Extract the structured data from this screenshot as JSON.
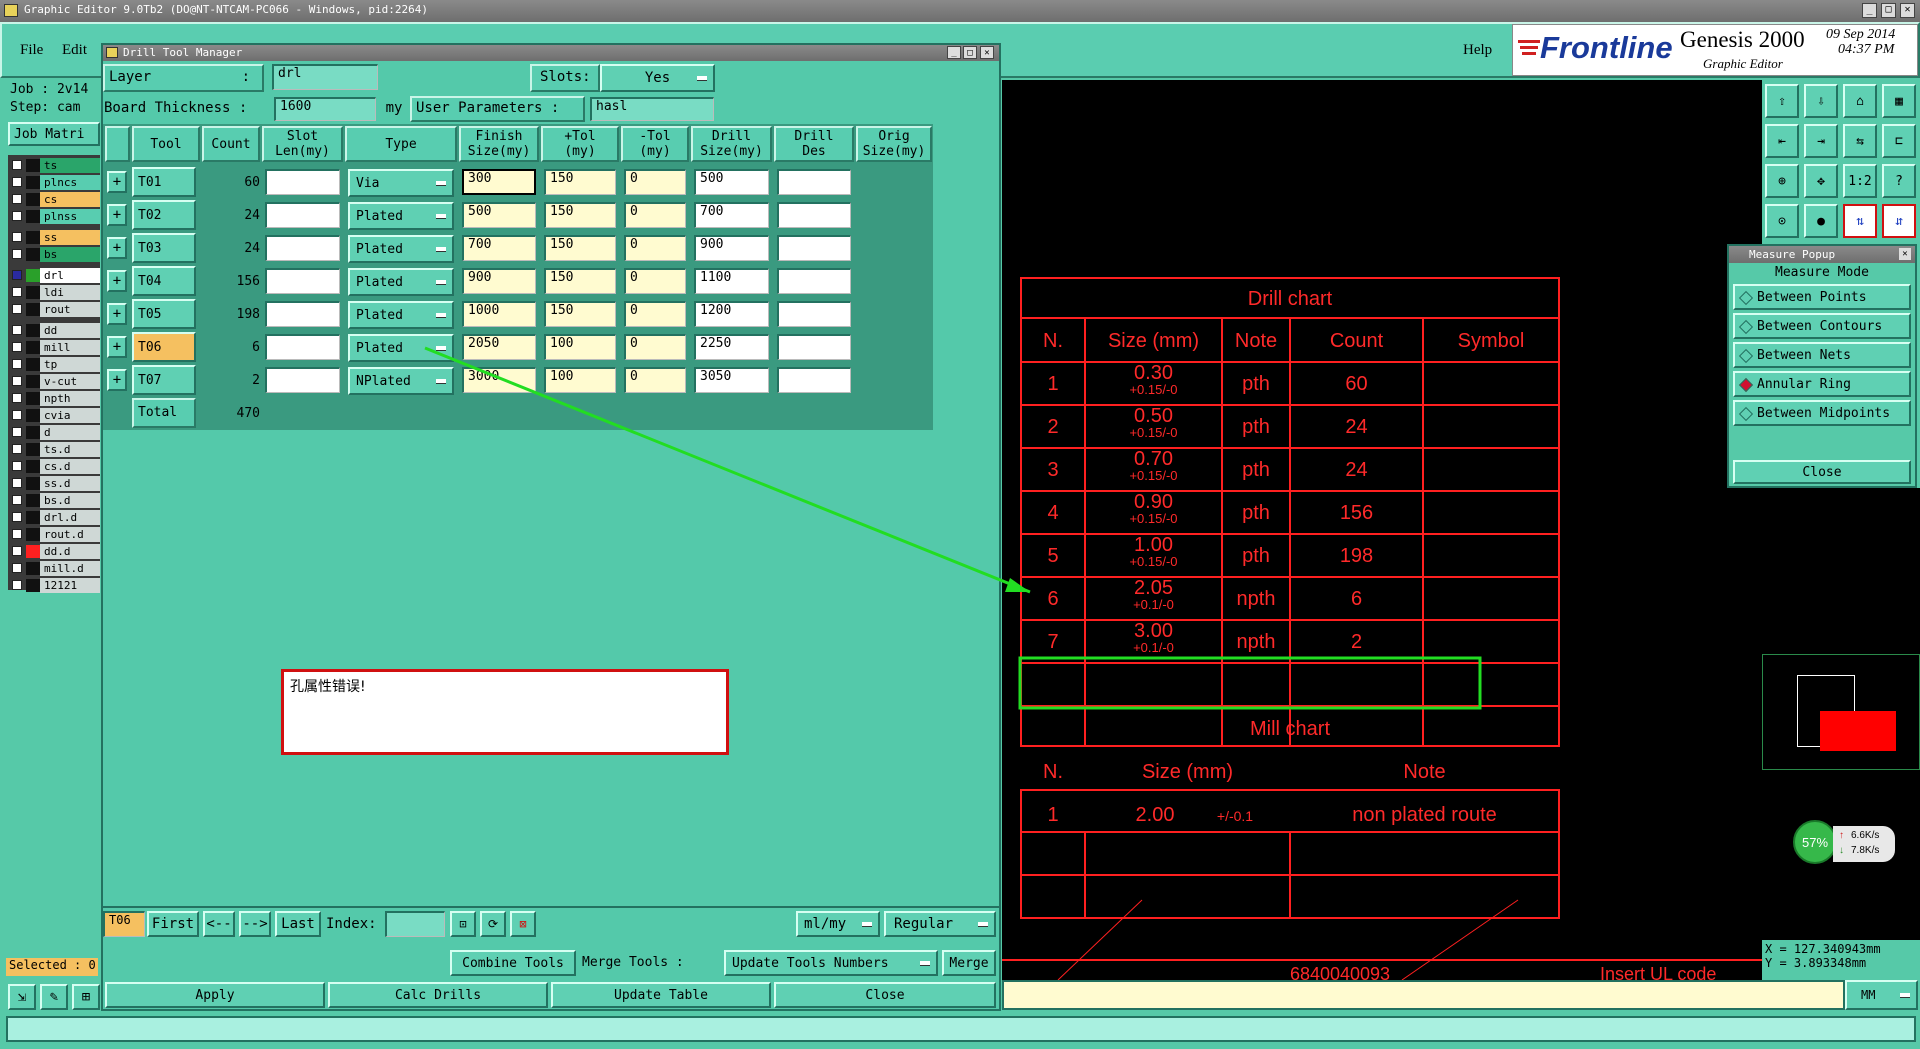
{
  "window_title": "Graphic Editor 9.0Tb2 (DO@NT-NTCAM-PC066 - Windows, pid:2264)",
  "menu": {
    "file": "File",
    "edit": "Edit",
    "help": "Help"
  },
  "brand": {
    "logo": "Frontline",
    "product": "Genesis 2000",
    "subtitle": "Graphic Editor",
    "date": "09 Sep 2014",
    "time": "04:37 PM"
  },
  "left_panel": {
    "job": "Job : 2v14",
    "step": "Step: cam",
    "matrix_btn": "Job Matri",
    "layers": [
      {
        "name": "ts",
        "color": "#2aa56a"
      },
      {
        "name": "plncs",
        "color": "#58cdb0"
      },
      {
        "name": "cs",
        "color": "#f5c060"
      },
      {
        "name": "plnss",
        "color": "#58cdb0"
      },
      {
        "name": "ss",
        "color": "#f5c060"
      },
      {
        "name": "bs",
        "color": "#2aa56a"
      },
      {
        "name": "drl",
        "color": "#ffffff"
      },
      {
        "name": "ldi",
        "color": "#cfd8d6"
      },
      {
        "name": "rout",
        "color": "#cfd8d6"
      },
      {
        "name": "dd",
        "color": "#cfd8d6"
      },
      {
        "name": "mill",
        "color": "#cfd8d6"
      },
      {
        "name": "tp",
        "color": "#cfd8d6"
      },
      {
        "name": "v-cut",
        "color": "#cfd8d6"
      },
      {
        "name": "npth",
        "color": "#cfd8d6"
      },
      {
        "name": "cvia",
        "color": "#cfd8d6"
      },
      {
        "name": "d",
        "color": "#cfd8d6"
      },
      {
        "name": "ts.d",
        "color": "#cfd8d6"
      },
      {
        "name": "cs.d",
        "color": "#cfd8d6"
      },
      {
        "name": "ss.d",
        "color": "#cfd8d6"
      },
      {
        "name": "bs.d",
        "color": "#cfd8d6"
      },
      {
        "name": "drl.d",
        "color": "#cfd8d6"
      },
      {
        "name": "rout.d",
        "color": "#cfd8d6"
      },
      {
        "name": "dd.d",
        "color": "#cfd8d6"
      },
      {
        "name": "mill.d",
        "color": "#cfd8d6"
      },
      {
        "name": "12121",
        "color": "#cfd8d6"
      }
    ],
    "selected": "Selected : 0"
  },
  "dtm": {
    "title": "Drill Tool Manager",
    "layer_label": "Layer",
    "layer_colon": ":",
    "layer_value": "drl",
    "slots_label": "Slots:",
    "slots_value": "Yes",
    "thickness_label": "Board Thickness :",
    "thickness_value": "1600",
    "thickness_unit": "my",
    "user_params_label": "User Parameters :",
    "user_params_value": "hasl",
    "headers": [
      "Tool",
      "Count",
      "Slot\nLen(my)",
      "Type",
      "Finish\nSize(my)",
      "+Tol\n(my)",
      "-Tol\n(my)",
      "Drill\nSize(my)",
      "Drill\nDes",
      "Orig\nSize(my)"
    ],
    "rows": [
      {
        "tool": "T01",
        "count": "60",
        "type": "Via",
        "finish": "300",
        "ptol": "150",
        "mtol": "0",
        "drill": "500"
      },
      {
        "tool": "T02",
        "count": "24",
        "type": "Plated",
        "finish": "500",
        "ptol": "150",
        "mtol": "0",
        "drill": "700"
      },
      {
        "tool": "T03",
        "count": "24",
        "type": "Plated",
        "finish": "700",
        "ptol": "150",
        "mtol": "0",
        "drill": "900"
      },
      {
        "tool": "T04",
        "count": "156",
        "type": "Plated",
        "finish": "900",
        "ptol": "150",
        "mtol": "0",
        "drill": "1100"
      },
      {
        "tool": "T05",
        "count": "198",
        "type": "Plated",
        "finish": "1000",
        "ptol": "150",
        "mtol": "0",
        "drill": "1200"
      },
      {
        "tool": "T06",
        "count": "6",
        "type": "Plated",
        "finish": "2050",
        "ptol": "100",
        "mtol": "0",
        "drill": "2250"
      },
      {
        "tool": "T07",
        "count": "2",
        "type": "NPlated",
        "finish": "3000",
        "ptol": "100",
        "mtol": "0",
        "drill": "3050"
      }
    ],
    "total_label": "Total",
    "total_value": "470",
    "note": "孔属性错误!",
    "nav": {
      "current": "T06",
      "first": "First",
      "prev": "<--",
      "next": "-->",
      "last": "Last",
      "index": "Index:",
      "units": "ml/my",
      "mode": "Regular"
    },
    "row2": {
      "combine": "Combine Tools",
      "merge_label": "Merge Tools :",
      "update_nums": "Update Tools Numbers",
      "merge": "Merge"
    },
    "actions": {
      "apply": "Apply",
      "calc": "Calc Drills",
      "update": "Update Table",
      "close": "Close"
    }
  },
  "drill_chart": {
    "title": "Drill chart",
    "headers": [
      "N.",
      "Size (mm)",
      "Note",
      "Count",
      "Symbol"
    ],
    "rows": [
      {
        "n": "1",
        "size": "0.30",
        "tol": "+0.15/-0",
        "note": "pth",
        "count": "60"
      },
      {
        "n": "2",
        "size": "0.50",
        "tol": "+0.15/-0",
        "note": "pth",
        "count": "24"
      },
      {
        "n": "3",
        "size": "0.70",
        "tol": "+0.15/-0",
        "note": "pth",
        "count": "24"
      },
      {
        "n": "4",
        "size": "0.90",
        "tol": "+0.15/-0",
        "note": "pth",
        "count": "156"
      },
      {
        "n": "5",
        "size": "1.00",
        "tol": "+0.15/-0",
        "note": "pth",
        "count": "198"
      },
      {
        "n": "6",
        "size": "2.05",
        "tol": "+0.1/-0",
        "note": "npth",
        "count": "6"
      },
      {
        "n": "7",
        "size": "3.00",
        "tol": "+0.1/-0",
        "note": "npth",
        "count": "2"
      }
    ]
  },
  "mill_chart": {
    "title": "Mill chart",
    "headers": [
      "N.",
      "Size (mm)",
      "Note"
    ],
    "row": {
      "n": "1",
      "size": "2.00",
      "tol": "+/-0.1",
      "note": "non plated route"
    }
  },
  "canvas_bottom": {
    "code": "6840040093",
    "insert": "Insert UL code"
  },
  "measure": {
    "title": "Measure Popup",
    "mode": "Measure Mode",
    "options": [
      "Between Points",
      "Between Contours",
      "Between Nets",
      "Annular Ring",
      "Between Midpoints"
    ],
    "close": "Close"
  },
  "net": {
    "percent": "57%",
    "up": "6.6K/s",
    "down": "7.8K/s"
  },
  "coords": {
    "x": "X = 127.340943mm",
    "y": "Y = 3.893348mm"
  },
  "units_select": "MM"
}
